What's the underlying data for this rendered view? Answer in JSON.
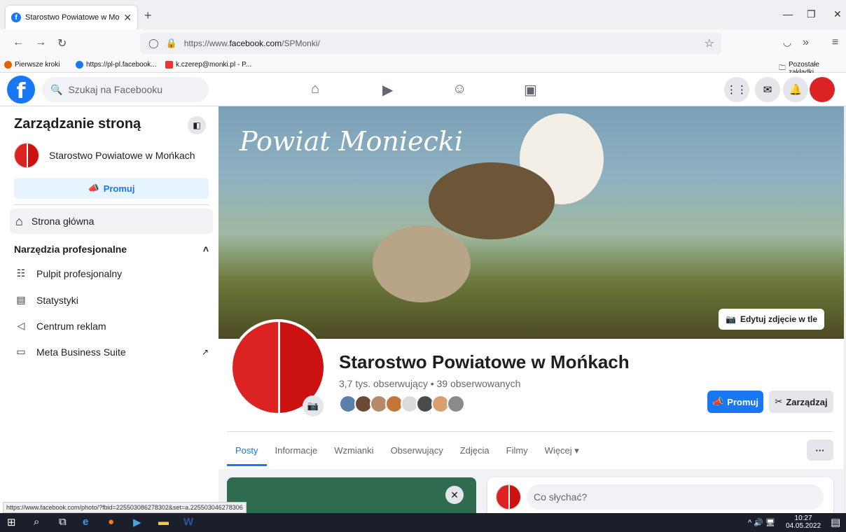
{
  "browser": {
    "tab_title": "Starostwo Powiatowe w Mońka",
    "url_prefix": "https://www.",
    "url_domain": "facebook.com",
    "url_path": "/SPMonki/",
    "bookmarks": [
      "Pierwsze kroki",
      "https://pl-pl.facebook...",
      "k.czerep@monki.pl - P..."
    ],
    "other_bookmarks": "Pozostałe zakładki",
    "status_url": "https://www.facebook.com/photo/?fbid=225503086278302&set=a.225503046278306"
  },
  "fb": {
    "search_placeholder": "Szukaj na Facebooku"
  },
  "sidebar": {
    "title": "Zarządzanie stroną",
    "page_name": "Starostwo Powiatowe w Mońkach",
    "promote_label": "Promuj",
    "home_label": "Strona główna",
    "section_label": "Narzędzia profesjonalne",
    "items": [
      {
        "label": "Pulpit profesjonalny"
      },
      {
        "label": "Statystyki"
      },
      {
        "label": "Centrum reklam"
      },
      {
        "label": "Meta Business Suite"
      }
    ]
  },
  "page": {
    "cover_title": "Powiat Moniecki",
    "edit_cover_label": "Edytuj zdjęcie w tle",
    "name": "Starostwo Powiatowe w Mońkach",
    "stats": "3,7 tys. obserwujący • 39 obserwowanych",
    "promote_label": "Promuj",
    "manage_label": "Zarządzaj",
    "tabs": [
      "Posty",
      "Informacje",
      "Wzmianki",
      "Obserwujący",
      "Zdjęcia",
      "Filmy",
      "Więcej ▾"
    ],
    "active_tab": "Posty",
    "composer_placeholder": "Co słychać?",
    "follower_colors": [
      "#5a7fa8",
      "#6b4a3a",
      "#b58a6a",
      "#c2763a",
      "#dcdcdc",
      "#4a4a4a",
      "#d8a070",
      "#8a8a8a"
    ]
  },
  "taskbar": {
    "time": "10:27",
    "date": "04.05.2022"
  },
  "colors": {
    "fb_blue": "#1877f2",
    "accent_light": "#e7f3ff",
    "taskbar": "#1a1f2b"
  }
}
